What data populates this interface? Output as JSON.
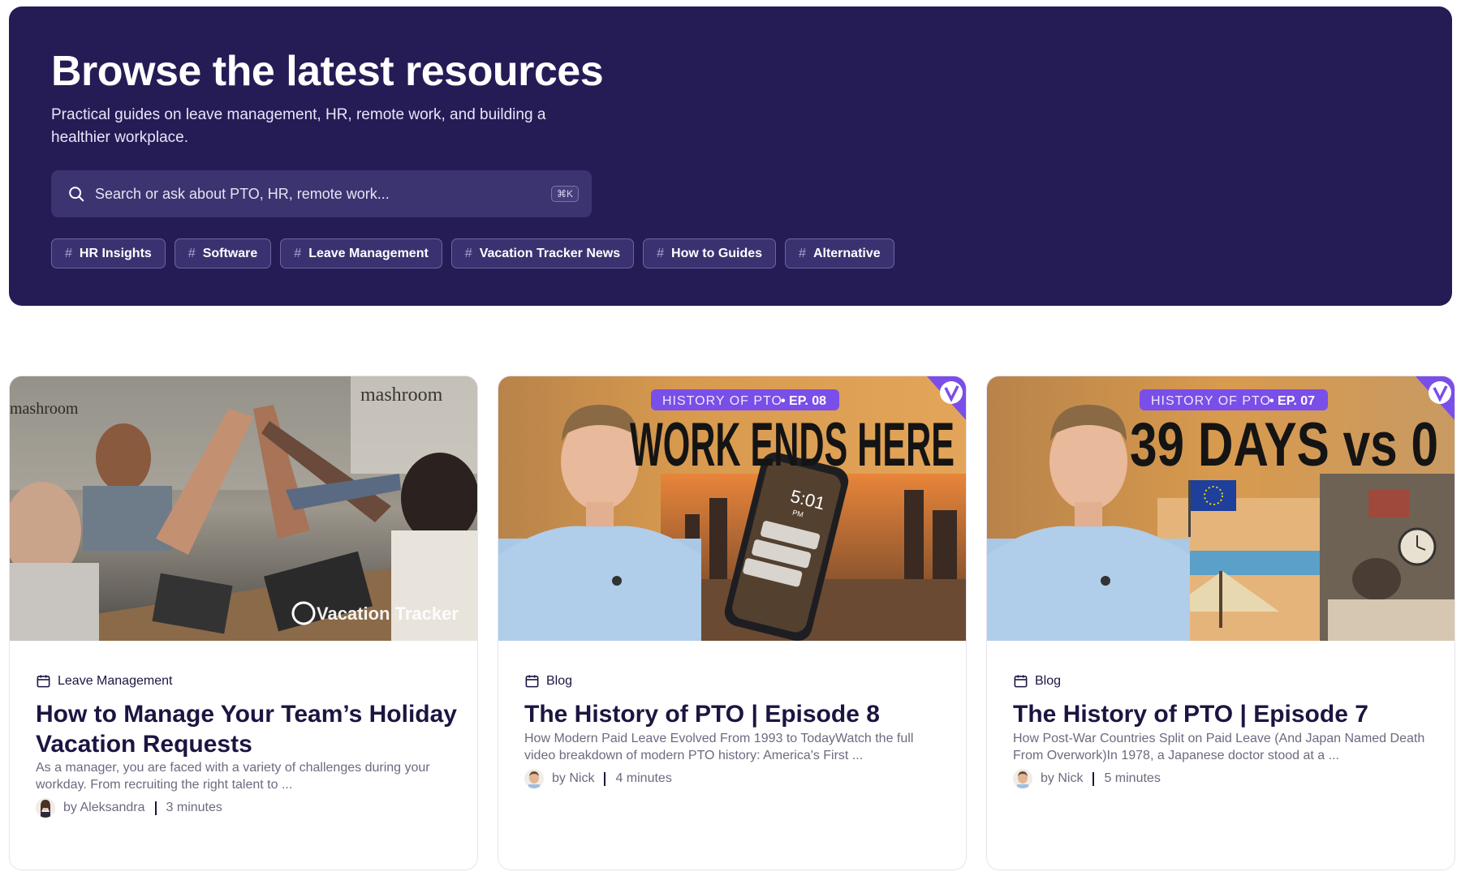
{
  "hero": {
    "title": "Browse the latest resources",
    "subtitle": "Practical guides on leave management, HR, remote work, and building a healthier workplace.",
    "search": {
      "placeholder": "Search or ask about PTO, HR, remote work...",
      "value": "",
      "shortcut": "⌘K",
      "icon": "search-icon"
    },
    "tags": [
      "HR Insights",
      "Software",
      "Leave Management",
      "Vacation Tracker News",
      "How to Guides",
      "Alternative"
    ],
    "hash": "#"
  },
  "cards": [
    {
      "category": "Leave Management",
      "title": "How to Manage Your Team’s Holiday Vacation Requests",
      "excerpt": "As a manager, you are faced with a variety of challenges during your workday. From recruiting the right talent to ...",
      "author": "by Aleksandra",
      "read_time": "3 minutes",
      "image": {
        "wall_text": "mashroom",
        "wall_text2": "mashroom",
        "watermark": "Vacation Tracker"
      }
    },
    {
      "category": "Blog",
      "title": "The History of PTO | Episode 8",
      "excerpt": "How Modern Paid Leave Evolved From 1993 to TodayWatch the full video breakdown of modern PTO history: America's First ...",
      "author": "by Nick",
      "read_time": "4 minutes",
      "image": {
        "episode_label": "HISTORY OF PTO",
        "episode_num": "• EP. 08",
        "headline": "WORK ENDS HERE",
        "phone_time": "5:01",
        "phone_pm": "PM"
      }
    },
    {
      "category": "Blog",
      "title": "The History of PTO | Episode 7",
      "excerpt": "How Post-War Countries Split on Paid Leave (And Japan Named Death From Overwork)In 1978, a Japanese doctor stood at a ...",
      "author": "by Nick",
      "read_time": "5 minutes",
      "image": {
        "episode_label": "HISTORY OF PTO",
        "episode_num": "• EP. 07",
        "headline": "39 DAYS vs 0"
      }
    }
  ],
  "colors": {
    "hero_bg": "#251c56",
    "accent_purple": "#6b3fe0",
    "title": "#1c1541"
  }
}
